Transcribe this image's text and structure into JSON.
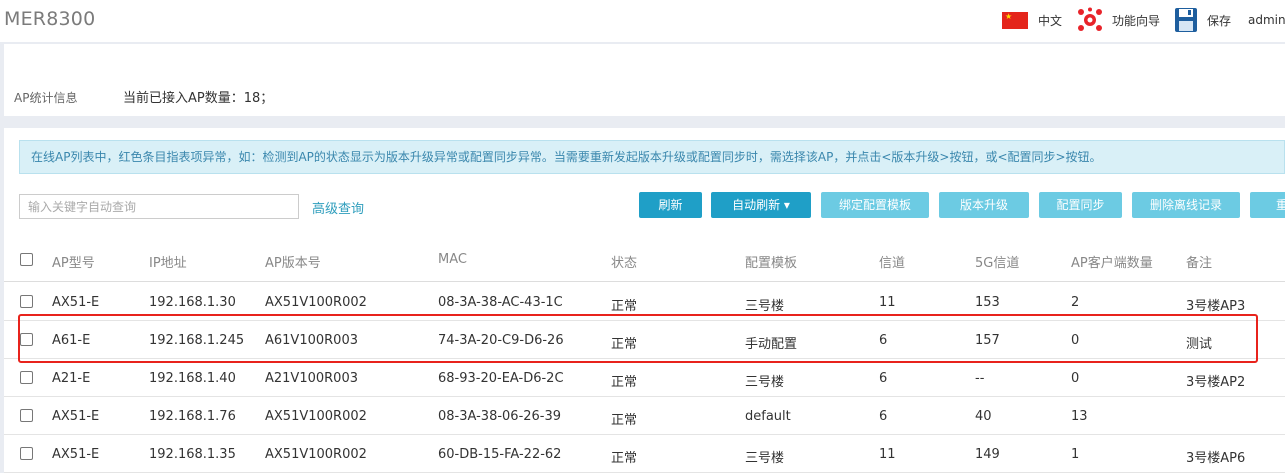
{
  "header": {
    "brand": "MER8300",
    "lang_label": "中文",
    "wizard_label": "功能向导",
    "save_label": "保存",
    "user": "admin"
  },
  "stats": {
    "label": "AP统计信息",
    "value": "当前已接入AP数量：18；"
  },
  "notice": "在线AP列表中，红色条目指表项异常，如：检测到AP的状态显示为版本升级异常或配置同步异常。当需要重新发起版本升级或配置同步时，需选择该AP，并点击<版本升级>按钮，或<配置同步>按钮。",
  "search": {
    "placeholder": "输入关键字自动查询",
    "advanced": "高级查询"
  },
  "toolbar": {
    "refresh": "刷新",
    "auto_refresh": "自动刷新 ▾",
    "bind_template": "绑定配置模板",
    "upgrade": "版本升级",
    "sync": "配置同步",
    "delete_offline": "删除离线记录",
    "reboot": "重启"
  },
  "columns": [
    "AP型号",
    "IP地址",
    "AP版本号",
    "MAC",
    "状态",
    "配置模板",
    "信道",
    "5G信道",
    "AP客户端数量",
    "备注"
  ],
  "rows": [
    [
      "AX51-E",
      "192.168.1.30",
      "AX51V100R002",
      "08-3A-38-AC-43-1C",
      "正常",
      "三号楼",
      "11",
      "153",
      "2",
      "3号楼AP3"
    ],
    [
      "A61-E",
      "192.168.1.245",
      "A61V100R003",
      "74-3A-20-C9-D6-26",
      "正常",
      "手动配置",
      "6",
      "157",
      "0",
      "测试"
    ],
    [
      "A21-E",
      "192.168.1.40",
      "A21V100R003",
      "68-93-20-EA-D6-2C",
      "正常",
      "三号楼",
      "6",
      "--",
      "0",
      "3号楼AP2"
    ],
    [
      "AX51-E",
      "192.168.1.76",
      "AX51V100R002",
      "08-3A-38-06-26-39",
      "正常",
      "default",
      "6",
      "40",
      "13",
      ""
    ],
    [
      "AX51-E",
      "192.168.1.35",
      "AX51V100R002",
      "60-DB-15-FA-22-62",
      "正常",
      "三号楼",
      "11",
      "149",
      "1",
      "3号楼AP6"
    ]
  ],
  "colors": {
    "accent": "#1f9fc7",
    "accent_light": "#6ccbe3",
    "highlight": "#e8231c",
    "notice_text": "#3a87ad"
  }
}
